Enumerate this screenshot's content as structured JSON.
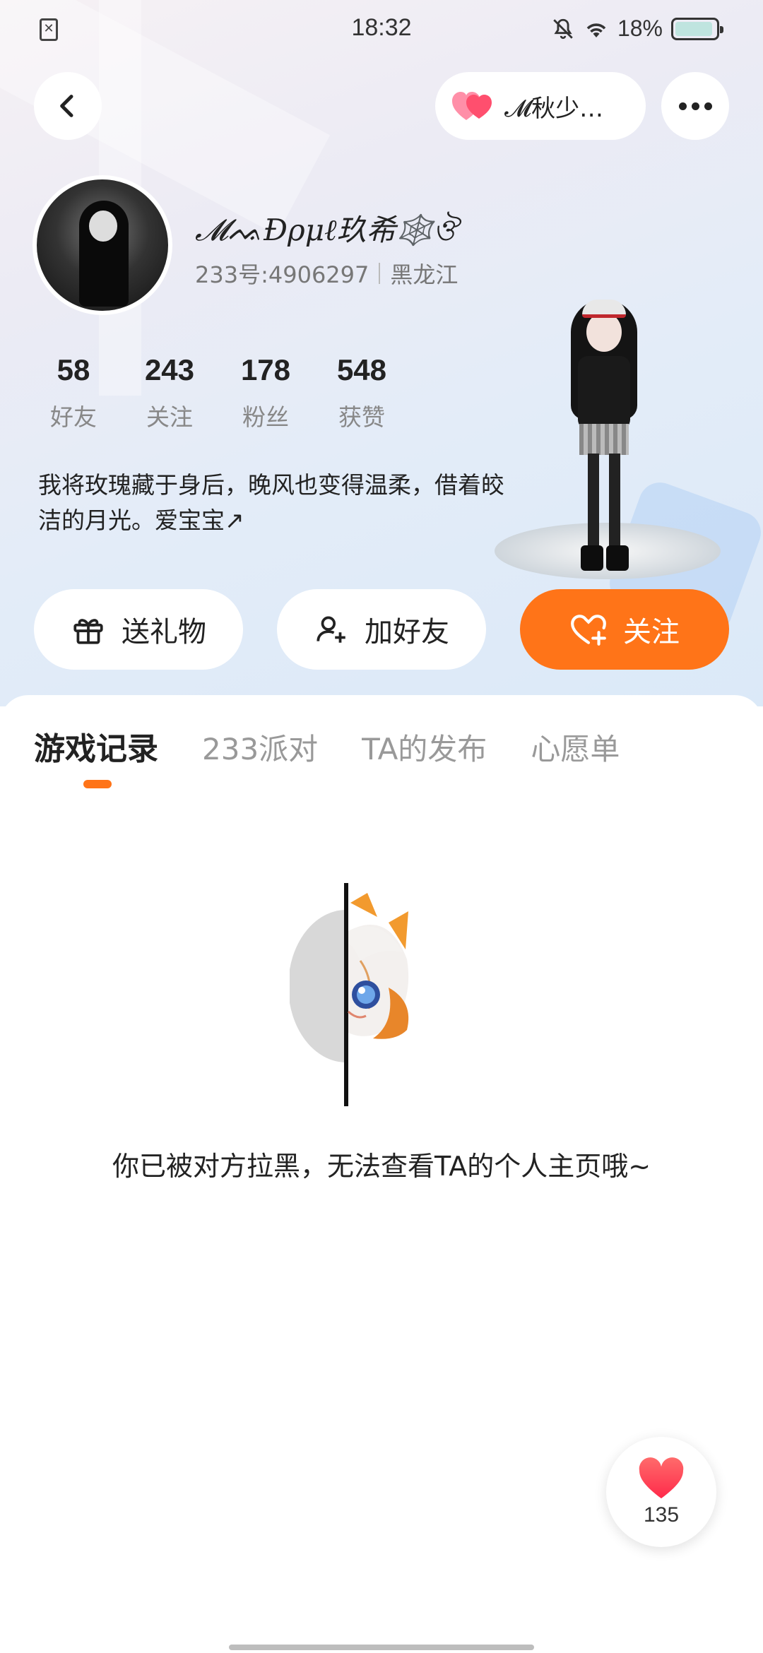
{
  "status_bar": {
    "time": "18:32",
    "battery": "18%"
  },
  "header": {
    "intimacy_pill_label": "𝓜秋少…"
  },
  "profile": {
    "name": "𝓜ᨕĐρμℓ玖希🕸️ঔ",
    "uid": "233号:4906297",
    "region": "黑龙江",
    "bio": "我将玫瑰藏于身后，晚风也变得温柔，借着皎洁的月光。爱宝宝↗"
  },
  "stats": [
    {
      "value": "58",
      "label": "好友"
    },
    {
      "value": "243",
      "label": "关注"
    },
    {
      "value": "178",
      "label": "粉丝"
    },
    {
      "value": "548",
      "label": "获赞"
    }
  ],
  "actions": {
    "gift": "送礼物",
    "add_friend": "加好友",
    "follow": "关注"
  },
  "tabs": [
    {
      "label": "游戏记录",
      "active": true
    },
    {
      "label": "233派对",
      "active": false
    },
    {
      "label": "TA的发布",
      "active": false
    },
    {
      "label": "心愿单",
      "active": false
    }
  ],
  "empty_state": {
    "message": "你已被对方拉黑，无法查看TA的个人主页哦~"
  },
  "like_button": {
    "count": "135"
  },
  "colors": {
    "accent": "#ff7418",
    "heart": "#ff3b4e"
  }
}
